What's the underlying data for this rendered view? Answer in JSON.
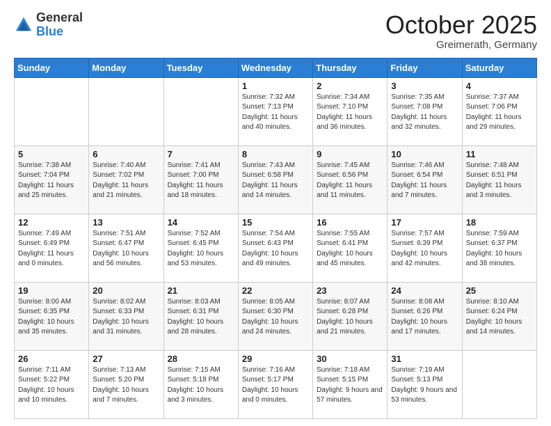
{
  "header": {
    "logo_general": "General",
    "logo_blue": "Blue",
    "title": "October 2025",
    "location": "Greimerath, Germany"
  },
  "days_of_week": [
    "Sunday",
    "Monday",
    "Tuesday",
    "Wednesday",
    "Thursday",
    "Friday",
    "Saturday"
  ],
  "weeks": [
    [
      {
        "day": "",
        "info": ""
      },
      {
        "day": "",
        "info": ""
      },
      {
        "day": "",
        "info": ""
      },
      {
        "day": "1",
        "info": "Sunrise: 7:32 AM\nSunset: 7:13 PM\nDaylight: 11 hours\nand 40 minutes."
      },
      {
        "day": "2",
        "info": "Sunrise: 7:34 AM\nSunset: 7:10 PM\nDaylight: 11 hours\nand 36 minutes."
      },
      {
        "day": "3",
        "info": "Sunrise: 7:35 AM\nSunset: 7:08 PM\nDaylight: 11 hours\nand 32 minutes."
      },
      {
        "day": "4",
        "info": "Sunrise: 7:37 AM\nSunset: 7:06 PM\nDaylight: 11 hours\nand 29 minutes."
      }
    ],
    [
      {
        "day": "5",
        "info": "Sunrise: 7:38 AM\nSunset: 7:04 PM\nDaylight: 11 hours\nand 25 minutes."
      },
      {
        "day": "6",
        "info": "Sunrise: 7:40 AM\nSunset: 7:02 PM\nDaylight: 11 hours\nand 21 minutes."
      },
      {
        "day": "7",
        "info": "Sunrise: 7:41 AM\nSunset: 7:00 PM\nDaylight: 11 hours\nand 18 minutes."
      },
      {
        "day": "8",
        "info": "Sunrise: 7:43 AM\nSunset: 6:58 PM\nDaylight: 11 hours\nand 14 minutes."
      },
      {
        "day": "9",
        "info": "Sunrise: 7:45 AM\nSunset: 6:56 PM\nDaylight: 11 hours\nand 11 minutes."
      },
      {
        "day": "10",
        "info": "Sunrise: 7:46 AM\nSunset: 6:54 PM\nDaylight: 11 hours\nand 7 minutes."
      },
      {
        "day": "11",
        "info": "Sunrise: 7:48 AM\nSunset: 6:51 PM\nDaylight: 11 hours\nand 3 minutes."
      }
    ],
    [
      {
        "day": "12",
        "info": "Sunrise: 7:49 AM\nSunset: 6:49 PM\nDaylight: 11 hours\nand 0 minutes."
      },
      {
        "day": "13",
        "info": "Sunrise: 7:51 AM\nSunset: 6:47 PM\nDaylight: 10 hours\nand 56 minutes."
      },
      {
        "day": "14",
        "info": "Sunrise: 7:52 AM\nSunset: 6:45 PM\nDaylight: 10 hours\nand 53 minutes."
      },
      {
        "day": "15",
        "info": "Sunrise: 7:54 AM\nSunset: 6:43 PM\nDaylight: 10 hours\nand 49 minutes."
      },
      {
        "day": "16",
        "info": "Sunrise: 7:55 AM\nSunset: 6:41 PM\nDaylight: 10 hours\nand 45 minutes."
      },
      {
        "day": "17",
        "info": "Sunrise: 7:57 AM\nSunset: 6:39 PM\nDaylight: 10 hours\nand 42 minutes."
      },
      {
        "day": "18",
        "info": "Sunrise: 7:59 AM\nSunset: 6:37 PM\nDaylight: 10 hours\nand 38 minutes."
      }
    ],
    [
      {
        "day": "19",
        "info": "Sunrise: 8:00 AM\nSunset: 6:35 PM\nDaylight: 10 hours\nand 35 minutes."
      },
      {
        "day": "20",
        "info": "Sunrise: 8:02 AM\nSunset: 6:33 PM\nDaylight: 10 hours\nand 31 minutes."
      },
      {
        "day": "21",
        "info": "Sunrise: 8:03 AM\nSunset: 6:31 PM\nDaylight: 10 hours\nand 28 minutes."
      },
      {
        "day": "22",
        "info": "Sunrise: 8:05 AM\nSunset: 6:30 PM\nDaylight: 10 hours\nand 24 minutes."
      },
      {
        "day": "23",
        "info": "Sunrise: 8:07 AM\nSunset: 6:28 PM\nDaylight: 10 hours\nand 21 minutes."
      },
      {
        "day": "24",
        "info": "Sunrise: 8:08 AM\nSunset: 6:26 PM\nDaylight: 10 hours\nand 17 minutes."
      },
      {
        "day": "25",
        "info": "Sunrise: 8:10 AM\nSunset: 6:24 PM\nDaylight: 10 hours\nand 14 minutes."
      }
    ],
    [
      {
        "day": "26",
        "info": "Sunrise: 7:11 AM\nSunset: 5:22 PM\nDaylight: 10 hours\nand 10 minutes."
      },
      {
        "day": "27",
        "info": "Sunrise: 7:13 AM\nSunset: 5:20 PM\nDaylight: 10 hours\nand 7 minutes."
      },
      {
        "day": "28",
        "info": "Sunrise: 7:15 AM\nSunset: 5:18 PM\nDaylight: 10 hours\nand 3 minutes."
      },
      {
        "day": "29",
        "info": "Sunrise: 7:16 AM\nSunset: 5:17 PM\nDaylight: 10 hours\nand 0 minutes."
      },
      {
        "day": "30",
        "info": "Sunrise: 7:18 AM\nSunset: 5:15 PM\nDaylight: 9 hours\nand 57 minutes."
      },
      {
        "day": "31",
        "info": "Sunrise: 7:19 AM\nSunset: 5:13 PM\nDaylight: 9 hours\nand 53 minutes."
      },
      {
        "day": "",
        "info": ""
      }
    ]
  ]
}
